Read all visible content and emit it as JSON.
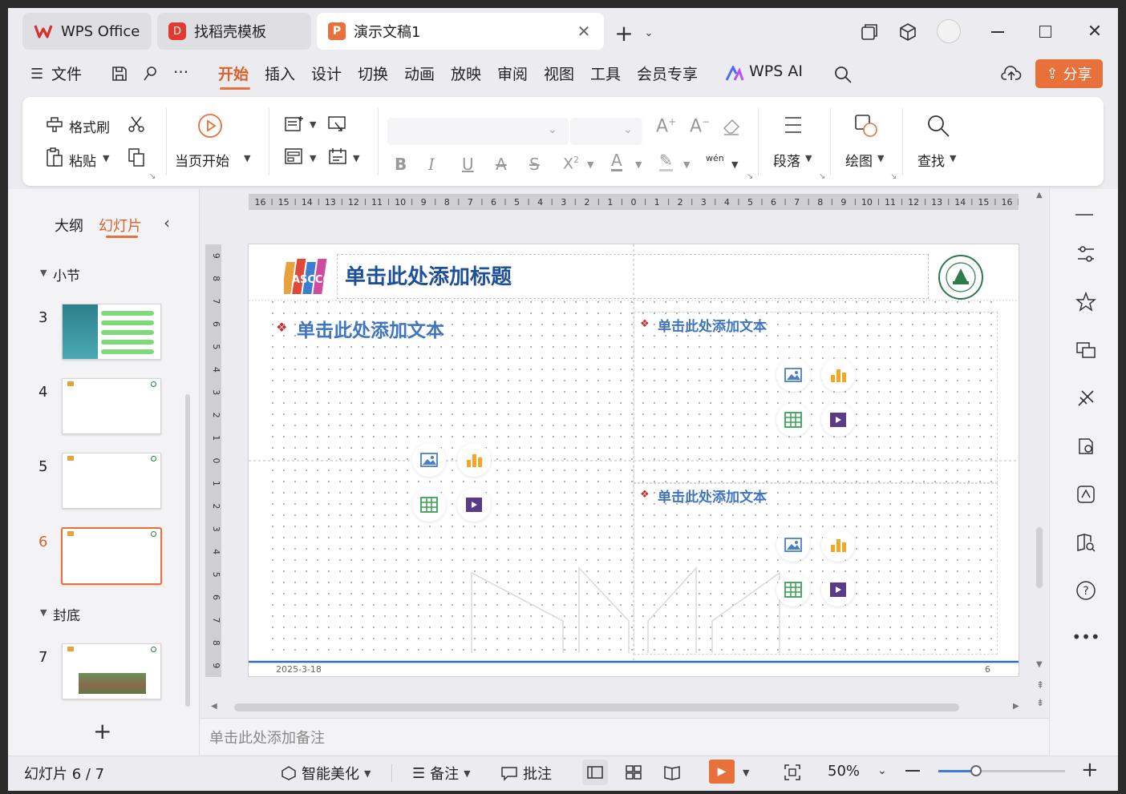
{
  "tabs": [
    {
      "label": "WPS Office"
    },
    {
      "label": "找稻壳模板"
    },
    {
      "label": "演示文稿1"
    }
  ],
  "menu": {
    "file": "文件",
    "items": [
      "开始",
      "插入",
      "设计",
      "切换",
      "动画",
      "放映",
      "审阅",
      "视图",
      "工具",
      "会员专享"
    ],
    "ai": "WPS AI",
    "share": "分享"
  },
  "toolbar": {
    "format_painter": "格式刷",
    "paste": "粘贴",
    "play_from_current": "当页开始",
    "paragraph": "段落",
    "drawing": "绘图",
    "find": "查找",
    "phonetic": "wén"
  },
  "ruler": {
    "h_labels": [
      "16",
      "15",
      "14",
      "13",
      "12",
      "11",
      "10",
      "9",
      "8",
      "7",
      "6",
      "5",
      "4",
      "3",
      "2",
      "1",
      "0",
      "1",
      "2",
      "3",
      "4",
      "5",
      "6",
      "7",
      "8",
      "9",
      "10",
      "11",
      "12",
      "13",
      "14",
      "15",
      "16"
    ],
    "v_labels": [
      "9",
      "8",
      "7",
      "6",
      "5",
      "4",
      "3",
      "2",
      "1",
      "0",
      "1",
      "2",
      "3",
      "4",
      "5",
      "6",
      "7",
      "8",
      "9"
    ]
  },
  "panel": {
    "outline": "大纲",
    "slides": "幻灯片",
    "section1": "小节",
    "section2": "封底",
    "thumbs": [
      {
        "num": "3"
      },
      {
        "num": "4"
      },
      {
        "num": "5"
      },
      {
        "num": "6"
      },
      {
        "num": "7"
      }
    ]
  },
  "slide": {
    "title_placeholder": "单击此处添加标题",
    "text_left": "单击此处添加文本",
    "text_right_top": "单击此处添加文本",
    "text_right_bottom": "单击此处添加文本",
    "date": "2025-3-18",
    "page": "6",
    "logo_text": "ASCCC"
  },
  "notes": {
    "placeholder": "单击此处添加备注"
  },
  "status": {
    "slide_info": "幻灯片 6 / 7",
    "beautify": "智能美化",
    "notes": "备注",
    "comment": "批注",
    "zoom": "50%",
    "zoom_level": 0.5
  },
  "colors": {
    "accent": "#e8703a",
    "placeholder_blue": "#3f74c1",
    "title_blue": "#1e4f99"
  }
}
